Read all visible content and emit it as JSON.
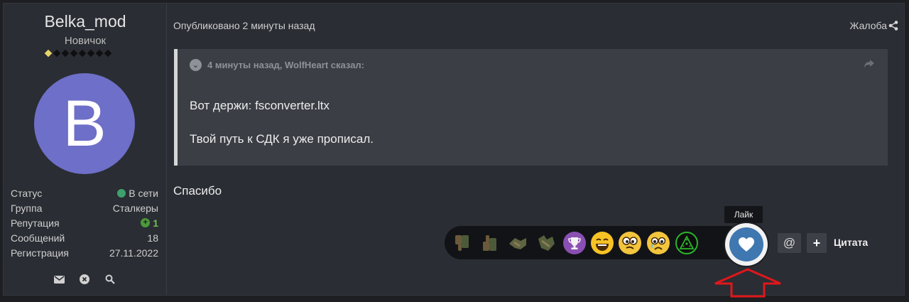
{
  "author": {
    "username": "Belka_mod",
    "rank": "Новичок",
    "rank_pips": {
      "filled": 1,
      "total": 8
    },
    "avatar_letter": "B",
    "avatar_color": "#6e6fc8",
    "stats": [
      {
        "label": "Статус",
        "value": "В сети"
      },
      {
        "label": "Группа",
        "value": "Сталкеры"
      },
      {
        "label": "Репутация",
        "value": "1"
      },
      {
        "label": "Сообщений",
        "value": "18"
      },
      {
        "label": "Регистрация",
        "value": "27.11.2022"
      }
    ],
    "actions": [
      "envelope-icon",
      "ignore-icon",
      "search-icon"
    ]
  },
  "post": {
    "published": "Опубликовано 2 минуты назад",
    "report": "Жалоба",
    "quote": {
      "header": "4 минуты назад, WolfHeart сказал:",
      "line1": "Вот держи: fsconverter.ltx",
      "line2": "Твой путь к СДК я уже прописал."
    },
    "text": "Спасибо"
  },
  "reactions": {
    "tooltip": "Лайк",
    "items": [
      "thumbs-down",
      "thumbs-up",
      "handshake",
      "handshake-alt",
      "trophy",
      "laugh",
      "confused",
      "sad",
      "radiation"
    ],
    "selected": "like",
    "like_color": "#3f77b1"
  },
  "controls": {
    "mention": "@",
    "plus": "+",
    "quote_label": "Цитата"
  },
  "colors": {
    "background": "#2a2d33",
    "quote_bg": "#3b3e45",
    "accent_red": "#e0171b",
    "online": "#3ea06e"
  }
}
